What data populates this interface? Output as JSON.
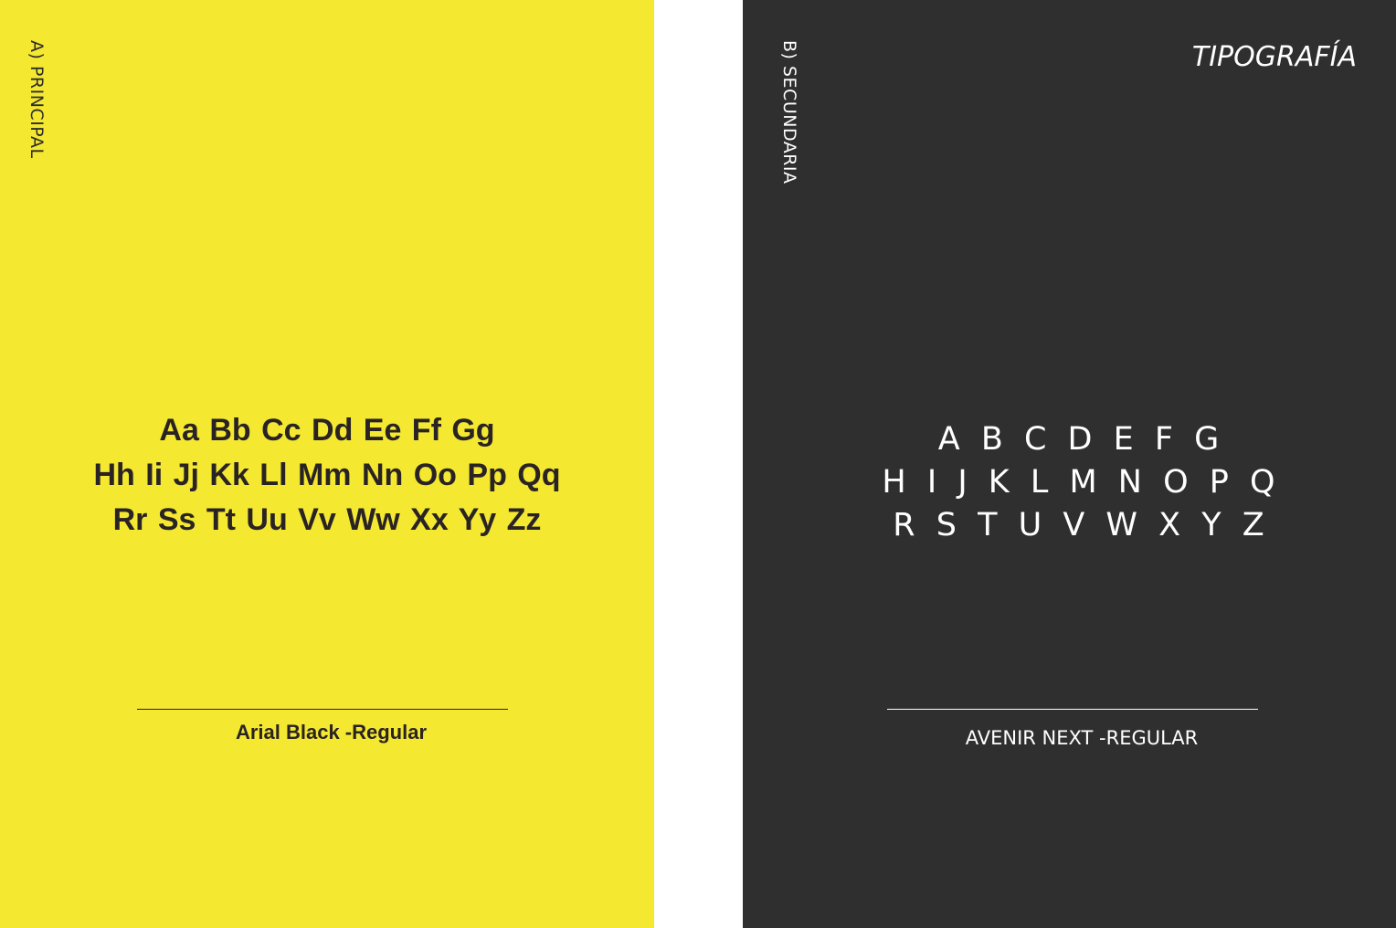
{
  "colors": {
    "primary_panel_bg": "#f4e831",
    "primary_text": "#2a2323",
    "secondary_panel_bg": "#2f2f2f",
    "secondary_text": "#ffffff",
    "gap_bg": "#ffffff"
  },
  "primary": {
    "side_label": "A) PRINCIPAL",
    "specimen_lines": [
      "Aa Bb Cc Dd Ee Ff Gg",
      "Hh Ii Jj Kk Ll Mm Nn Oo Pp Qq",
      "Rr Ss Tt Uu Vv Ww Xx Yy Zz"
    ],
    "font_name": "Arial Black -Regular"
  },
  "secondary": {
    "side_label": "B) SECUNDARIA",
    "section_title": "TIPOGRAFÍA",
    "specimen_lines": [
      "A B C D E F G",
      "H I J K L M N O P Q",
      "R S T U V W X Y Z"
    ],
    "font_name": "AVENIR NEXT -REGULAR"
  }
}
